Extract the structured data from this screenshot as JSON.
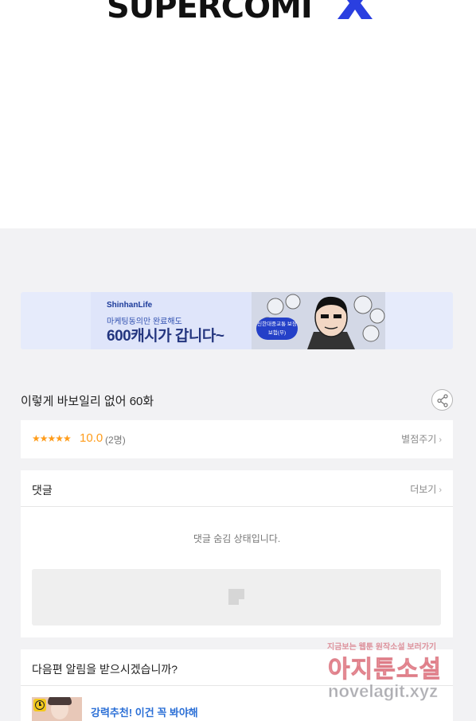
{
  "header": {
    "logo_text": "SUPERCOMI",
    "logo_accent_color": "#2a3fe0"
  },
  "banner": {
    "brand": "ShinhanLife",
    "subtitle": "마케팅동의만 완료해도",
    "headline": "600캐시가 갑니다~",
    "badge": "신한대중교통 보장보험(무)"
  },
  "episode": {
    "title": "이렇게 바보일리 없어 60화",
    "share_icon": "share-icon"
  },
  "rating": {
    "stars": "★★★★★",
    "score": "10.0",
    "votes": "(2명)",
    "rate_label": "별점주기",
    "accent_color": "#ff9c1a"
  },
  "comments": {
    "title": "댓글",
    "more_label": "더보기",
    "hidden_message": "댓글 숨김 상태입니다."
  },
  "next_episode": {
    "title": "다음편 알림을 받으시겠습니까?",
    "recommend_label": "강력추천! 이건 꼭 봐야해"
  },
  "watermark": {
    "top_line": "지금보는 웹툰 원작소설 보러가기",
    "main": "아지툰소설",
    "url": "novelagit.xyz"
  }
}
